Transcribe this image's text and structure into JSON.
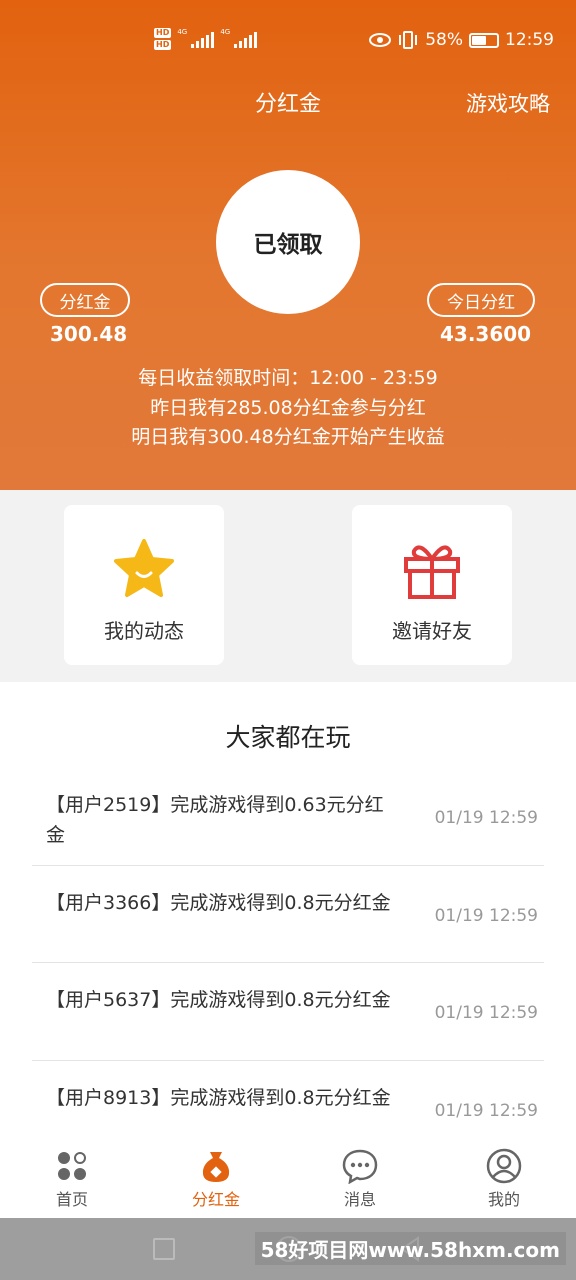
{
  "statusbar": {
    "hd1": "HD",
    "hd2": "HD",
    "net1": "4G",
    "net2": "4G",
    "battery_pct": "58%",
    "battery_level": 0.58,
    "time": "12:59"
  },
  "header": {
    "title": "分红金",
    "strategy_label": "游戏攻略",
    "claim_status": "已领取",
    "left_pill": "分红金",
    "left_amount": "300.48",
    "right_pill": "今日分红",
    "right_amount": "43.3600",
    "info_line1": "每日收益领取时间：12:00 - 23:59",
    "info_line2": "昨日我有285.08分红金参与分红",
    "info_line3": "明日我有300.48分红金开始产生收益",
    "gradient_top": "#e2620f"
  },
  "cards": {
    "left_label": "我的动态",
    "right_label": "邀请好友"
  },
  "feed": {
    "title": "大家都在玩",
    "items": [
      {
        "text": "【用户2519】完成游戏得到0.63元分红金",
        "time": "01/19 12:59"
      },
      {
        "text": "【用户3366】完成游戏得到0.8元分红金",
        "time": "01/19 12:59"
      },
      {
        "text": "【用户5637】完成游戏得到0.8元分红金",
        "time": "01/19 12:59"
      },
      {
        "text": "【用户8913】完成游戏得到0.8元分红金",
        "time": "01/19 12:59"
      }
    ]
  },
  "tabs": [
    {
      "label": "首页",
      "icon": "home-dots-icon"
    },
    {
      "label": "分红金",
      "icon": "money-bag-icon"
    },
    {
      "label": "消息",
      "icon": "chat-bubble-icon"
    },
    {
      "label": "我的",
      "icon": "user-icon"
    }
  ],
  "watermark": "58好项目网www.58hxm.com",
  "colors": {
    "accent": "#e2620f",
    "star": "#f5b817",
    "gift": "#e03c3c"
  }
}
